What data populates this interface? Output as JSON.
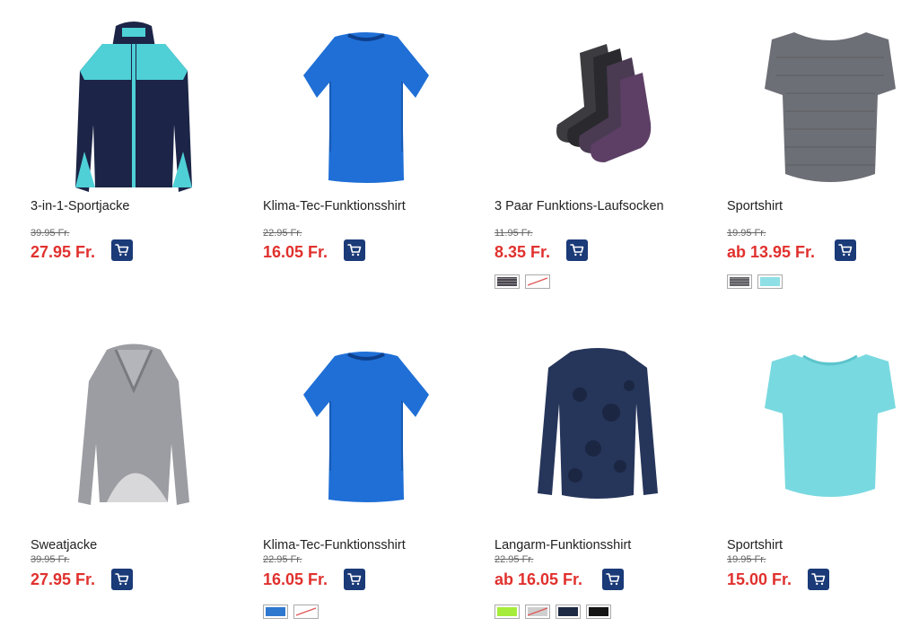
{
  "products": [
    {
      "name": "3-in-1-Sportjacke",
      "old_price": "39.95 Fr.",
      "price": "27.95 Fr.",
      "image": "jacket-navy-turquoise",
      "swatches": []
    },
    {
      "name": "Klima-Tec-Funktionsshirt",
      "old_price": "22.95 Fr.",
      "price": "16.05 Fr.",
      "image": "tshirt-blue",
      "swatches": []
    },
    {
      "name": "3 Paar Funktions-Laufsocken",
      "old_price": "11.95 Fr.",
      "price": "8.35 Fr.",
      "image": "socks-dark",
      "swatches": [
        {
          "color": "#4a4550",
          "type": "stripes"
        },
        {
          "color": "#ffffff",
          "type": "unavailable"
        }
      ]
    },
    {
      "name": "Sportshirt",
      "old_price": "19.95 Fr.",
      "price": "ab 13.95 Fr.",
      "image": "tshirt-grey",
      "swatches": [
        {
          "color": "#606066",
          "type": "stripes"
        },
        {
          "color": "#8fdfe6",
          "type": "solid"
        }
      ]
    },
    {
      "name": "Sweatjacke",
      "old_price": "39.95 Fr.",
      "price": "27.95 Fr.",
      "image": "cardigan-grey",
      "swatches": []
    },
    {
      "name": "Klima-Tec-Funktionsshirt",
      "old_price": "22.95 Fr.",
      "price": "16.05 Fr.",
      "image": "tshirt-blue",
      "swatches": [
        {
          "color": "#2f78d0",
          "type": "solid"
        },
        {
          "color": "#ffffff",
          "type": "unavailable"
        }
      ]
    },
    {
      "name": "Langarm-Funktionsshirt",
      "old_price": "22.95 Fr.",
      "price": "ab 16.05 Fr.",
      "image": "longsleeve-navy",
      "swatches": [
        {
          "color": "#a6ec3a",
          "type": "solid"
        },
        {
          "color": "#cfcfcf",
          "type": "unavailable"
        },
        {
          "color": "#1e2a44",
          "type": "solid"
        },
        {
          "color": "#151515",
          "type": "solid"
        }
      ]
    },
    {
      "name": "Sportshirt",
      "old_price": "19.95 Fr.",
      "price": "15.00 Fr.",
      "image": "tshirt-turquoise",
      "swatches": []
    }
  ],
  "colors": {
    "price": "#e0312e",
    "cart": "#1a3a78"
  },
  "icons": {
    "cart": "shopping-cart-icon"
  }
}
